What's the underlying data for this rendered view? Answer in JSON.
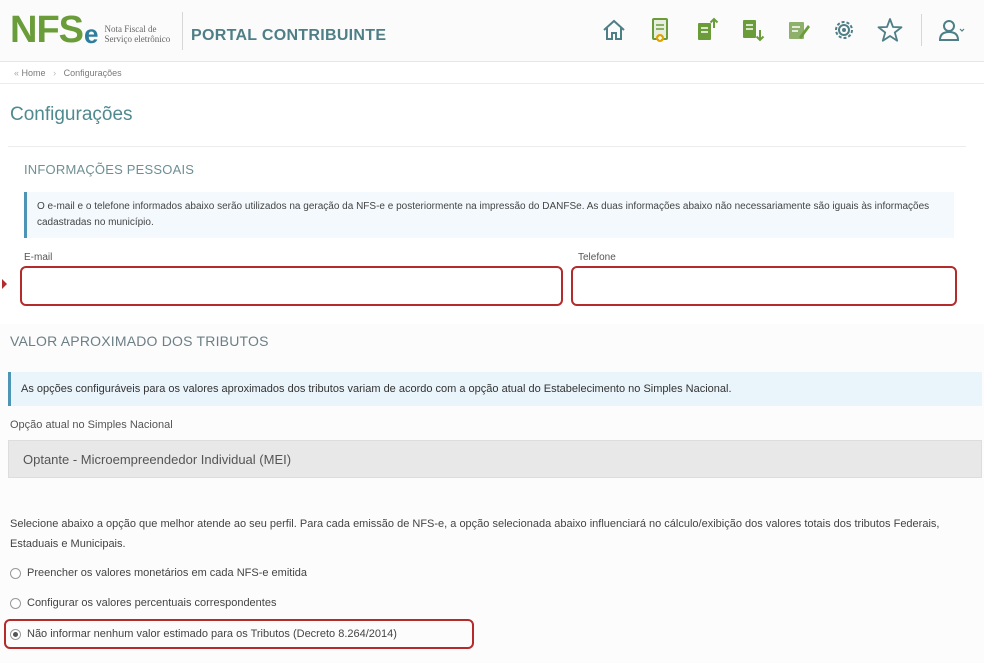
{
  "header": {
    "logo_main": "NFS",
    "logo_e": "e",
    "logo_sub_line1": "Nota Fiscal de",
    "logo_sub_line2": "Serviço eletrônico",
    "portal_title": "PORTAL CONTRIBUINTE",
    "nav_icons": [
      "home-icon",
      "invoice-add-icon",
      "invoice-upload-icon",
      "invoice-download-icon",
      "edit-document-icon",
      "gear-icon",
      "star-icon",
      "user-icon"
    ]
  },
  "breadcrumb": {
    "home": "Home",
    "current": "Configurações"
  },
  "page": {
    "title": "Configurações"
  },
  "personal": {
    "title": "INFORMAÇÕES PESSOAIS",
    "info": "O e-mail e o telefone informados abaixo serão utilizados na geração da NFS-e e posteriormente na impressão do DANFSe. As duas informações abaixo não necessariamente são iguais às informações cadastradas no município.",
    "email_label": "E-mail",
    "email_value": "",
    "phone_label": "Telefone",
    "phone_value": ""
  },
  "taxes": {
    "title": "VALOR APROXIMADO DOS TRIBUTOS",
    "info": "As opções configuráveis para os valores aproximados dos tributos variam de acordo com a opção atual do Estabelecimento no Simples Nacional.",
    "simples_label": "Opção atual no Simples Nacional",
    "simples_value": "Optante - Microempreendedor Individual (MEI)",
    "description": "Selecione abaixo a opção que melhor atende ao seu perfil. Para cada emissão de NFS-e, a opção selecionada abaixo influenciará no cálculo/exibição dos valores totais dos tributos Federais, Estaduais e Municipais.",
    "options": [
      {
        "label": "Preencher os valores monetários em cada NFS-e emitida",
        "checked": false
      },
      {
        "label": "Configurar os valores percentuais correspondentes",
        "checked": false
      },
      {
        "label": "Não informar nenhum valor estimado para os Tributos (Decreto 8.264/2014)",
        "checked": true
      }
    ]
  },
  "colors": {
    "brand_green": "#6a9c3a",
    "brand_teal": "#4e7f86",
    "highlight_red": "#b42b2b",
    "info_blue": "#4e95b5"
  }
}
